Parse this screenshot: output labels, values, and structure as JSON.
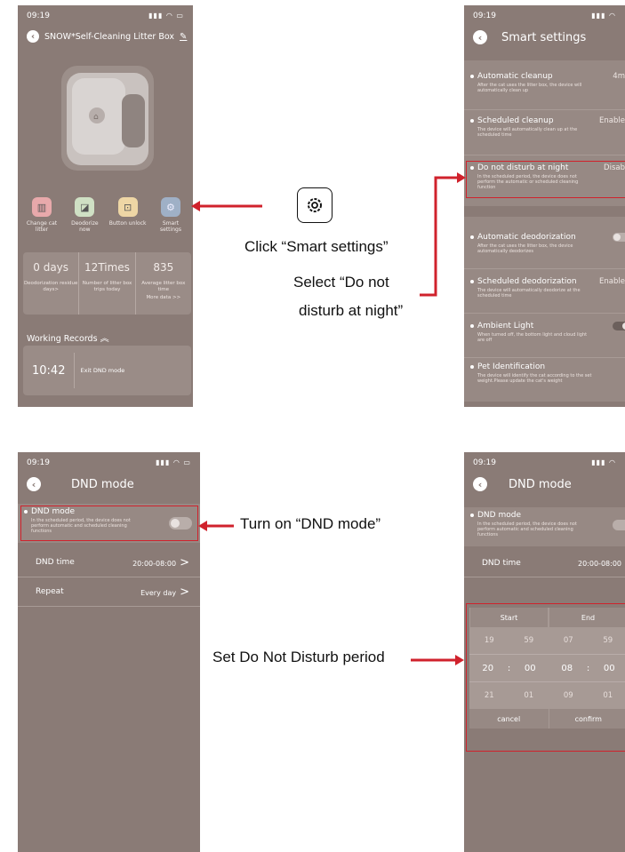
{
  "panel1": {
    "time": "09:19",
    "title": "SNOW*Self-Cleaning Litter Box",
    "actions": [
      {
        "label": "Change cat litter",
        "icon": "trash-icon",
        "color": "#e8a9ab"
      },
      {
        "label": "Deodorize now",
        "icon": "deodorize-icon",
        "color": "#cfe0c4"
      },
      {
        "label": "Button unlock",
        "icon": "unlock-icon",
        "color": "#eed6a5"
      },
      {
        "label": "Smart settings",
        "icon": "gear-icon",
        "color": "#9fb0c6"
      }
    ],
    "stats": [
      {
        "value": "0 days",
        "label": "Deodorization residue days>"
      },
      {
        "value": "12Times",
        "label": "Number of litter box trips today"
      },
      {
        "value": "835",
        "label": "Average litter box time"
      }
    ],
    "more_data": "More data >>",
    "records_title": "Working Records",
    "record": {
      "time": "10:42",
      "text": "Exit DND mode"
    }
  },
  "panel2": {
    "time": "09:19",
    "title": "Smart settings",
    "rows": [
      {
        "title": "Automatic cleanup",
        "value": "4m",
        "desc": "After the cat uses the litter box, the device will automatically clean up"
      },
      {
        "title": "Scheduled cleanup",
        "value": "Enable",
        "desc": "The device will automatically clean up at the scheduled time"
      },
      {
        "title": "Do not disturb at night",
        "value": "Disab",
        "desc": "In the scheduled period, the device does not perform the automatic or scheduled cleaning function"
      },
      {
        "title": "Automatic deodorization",
        "value": "",
        "desc": "After the cat uses the litter box, the device automatically deodorizes"
      },
      {
        "title": "Scheduled deodorization",
        "value": "Enable",
        "desc": "The device will automatically deodorize at the scheduled time"
      },
      {
        "title": "Ambient Light",
        "value": "",
        "desc": "When turned off, the bottom light and cloud light are off"
      },
      {
        "title": "Pet Identification",
        "value": "",
        "desc": "The device will identify the cat according to the set weight.Please update the cat's weight"
      }
    ]
  },
  "panel3": {
    "time": "09:19",
    "title": "DND mode",
    "dnd_title": "DND mode",
    "dnd_desc": "In the scheduled period, the device does not perform automatic and scheduled cleaning functions",
    "dnd_time_label": "DND time",
    "dnd_time_value": "20:00-08:00",
    "repeat_label": "Repeat",
    "repeat_value": "Every day"
  },
  "panel4": {
    "time": "09:19",
    "title": "DND mode",
    "dnd_title": "DND mode",
    "dnd_desc": "In the scheduled period, the device does not perform automatic and scheduled cleaning functions",
    "dnd_time_label": "DND time",
    "dnd_time_value": "20:00-08:00",
    "picker": {
      "start_label": "Start",
      "end_label": "End",
      "rows": [
        [
          "19",
          "59",
          "07",
          "59"
        ],
        [
          "20",
          "00",
          "08",
          "00"
        ],
        [
          "21",
          "01",
          "09",
          "01"
        ]
      ],
      "colon": ":",
      "cancel": "cancel",
      "confirm": "confirm"
    }
  },
  "annotations": {
    "click_smart": "Click “Smart settings”",
    "select_dnd_1": "Select “Do not",
    "select_dnd_2": "disturb at night”",
    "turn_on": "Turn on “DND mode”",
    "set_period": "Set Do Not Disturb period",
    "accent": "#d0222c"
  }
}
